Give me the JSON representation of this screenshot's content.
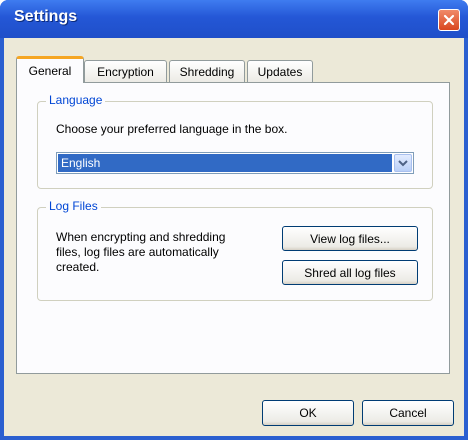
{
  "window": {
    "title": "Settings",
    "close_icon": "close-icon"
  },
  "tabs": [
    {
      "label": "General",
      "active": true
    },
    {
      "label": "Encryption",
      "active": false
    },
    {
      "label": "Shredding",
      "active": false
    },
    {
      "label": "Updates",
      "active": false
    }
  ],
  "language": {
    "group_label": "Language",
    "prompt": "Choose your preferred language in the box.",
    "selected": "English"
  },
  "log_files": {
    "group_label": "Log Files",
    "description_line1": "When encrypting and shredding",
    "description_line2": "files, log files are automatically",
    "description_line3": "created.",
    "view_button": "View log files...",
    "shred_button": "Shred all log files"
  },
  "footer": {
    "ok_label": "OK",
    "cancel_label": "Cancel"
  },
  "colors": {
    "title_bar": "#2457d6",
    "selection": "#316ac5",
    "active_tab_accent": "#f5a623",
    "group_label": "#0046d5",
    "close_button": "#d9461f"
  }
}
